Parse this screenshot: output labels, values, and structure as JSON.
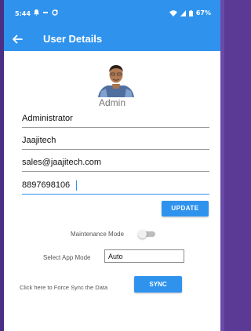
{
  "status_bar": {
    "time": "5:44",
    "battery": "67%",
    "icons": [
      "notification-icon",
      "sync-indicator-icon",
      "wifi-icon",
      "signal-icon",
      "battery-icon"
    ]
  },
  "app_bar": {
    "title": "User Details",
    "back_icon": "back-arrow-icon",
    "color": "#2f93ee"
  },
  "profile": {
    "display_name": "Admin",
    "avatar_icon": "avatar-photo"
  },
  "form": {
    "name": "Administrator",
    "company": "Jaajitech",
    "email": "sales@jaajitech.com",
    "phone": "8897698106",
    "update_label": "UPDATE"
  },
  "settings": {
    "maintenance_label": "Maintenance Mode",
    "maintenance_on": false,
    "app_mode_label": "Select App Mode",
    "app_mode_value": "Auto",
    "sync_label": "Click here to Force Sync the Data",
    "sync_button": "SYNC"
  }
}
